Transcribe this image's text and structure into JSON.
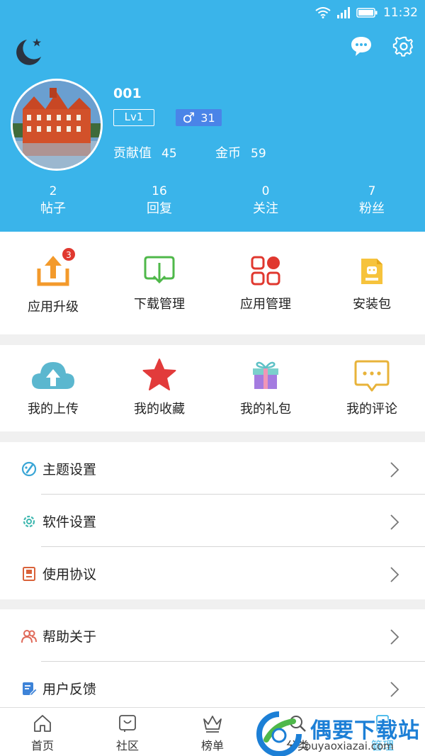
{
  "status_bar": {
    "time": "11:32"
  },
  "profile": {
    "username": "001",
    "level": "Lv1",
    "gender_symbol": "♂",
    "age": "31",
    "contribution_label": "贡献值",
    "contribution_value": "45",
    "coins_label": "金币",
    "coins_value": "59"
  },
  "counts": [
    {
      "value": "2",
      "label": "帖子"
    },
    {
      "value": "16",
      "label": "回复"
    },
    {
      "value": "0",
      "label": "关注"
    },
    {
      "value": "7",
      "label": "粉丝"
    }
  ],
  "app_grid": [
    {
      "label": "应用升级",
      "icon": "upload-box-icon",
      "badge": "3"
    },
    {
      "label": "下载管理",
      "icon": "download-tray-icon"
    },
    {
      "label": "应用管理",
      "icon": "app-grid-icon"
    },
    {
      "label": "安装包",
      "icon": "apk-file-icon"
    }
  ],
  "my_grid": [
    {
      "label": "我的上传",
      "icon": "cloud-upload-icon"
    },
    {
      "label": "我的收藏",
      "icon": "star-icon"
    },
    {
      "label": "我的礼包",
      "icon": "gift-icon"
    },
    {
      "label": "我的评论",
      "icon": "comment-bubble-icon"
    }
  ],
  "settings_list": [
    {
      "label": "主题设置",
      "icon": "palette-icon"
    },
    {
      "label": "软件设置",
      "icon": "gear-small-icon"
    },
    {
      "label": "使用协议",
      "icon": "agreement-icon"
    }
  ],
  "help_list": [
    {
      "label": "帮助关于",
      "icon": "people-icon"
    },
    {
      "label": "用户反馈",
      "icon": "feedback-icon"
    }
  ],
  "tabbar": [
    {
      "label": "首页",
      "icon": "home-icon"
    },
    {
      "label": "社区",
      "icon": "community-icon"
    },
    {
      "label": "榜单",
      "icon": "crown-icon"
    },
    {
      "label": "分类",
      "icon": "search-icon"
    },
    {
      "label": "管理",
      "icon": "manage-icon"
    }
  ],
  "watermark": {
    "title": "偶要下载站",
    "subtitle": "ouyaoxiazai.com"
  },
  "colors": {
    "header": "#3ab4ea",
    "accent_red": "#e0382f",
    "accent_orange": "#f39a2b",
    "accent_green": "#4fb84a"
  }
}
